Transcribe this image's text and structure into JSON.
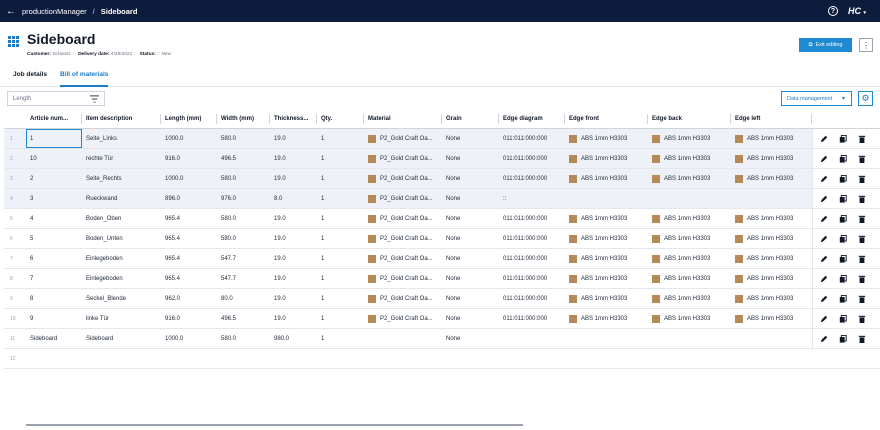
{
  "topbar": {
    "app": "productionManager",
    "separator": "/",
    "page": "Sideboard",
    "help": "?",
    "logo": "HC"
  },
  "header": {
    "title": "Sideboard",
    "customer_label": "Customer:",
    "customer": "Schwarz",
    "delivery_label": "Delivery date:",
    "delivery": "4/29/2022",
    "status_label": "Status:",
    "status": "New",
    "exit_label": "Exit editing"
  },
  "tabs": [
    {
      "label": "Job details",
      "active": false
    },
    {
      "label": "Bill of materials",
      "active": true
    }
  ],
  "filter": {
    "placeholder": "Length"
  },
  "toolbar": {
    "data_management": "Data management"
  },
  "columns": [
    "Article num...",
    "Item description",
    "Length (mm)",
    "Width (mm)",
    "Thickness...",
    "Qty.",
    "Material",
    "Grain",
    "Edge diagram",
    "Edge front",
    "Edge back",
    "Edge left"
  ],
  "rows": [
    {
      "n": "1",
      "article": "1",
      "desc": "Seite_Links",
      "length": "1000.0",
      "width": "580.0",
      "thick": "19.0",
      "qty": "1",
      "material": "P2_Gold Craft Oa...",
      "grain": "None",
      "diagram": "011:011:000:000",
      "front": "ABS 1mm H3303",
      "back": "ABS 1mm H3303",
      "left": "ABS 1mm H3303"
    },
    {
      "n": "2",
      "article": "10",
      "desc": "rechte Tür",
      "length": "916.0",
      "width": "496.5",
      "thick": "19.0",
      "qty": "1",
      "material": "P2_Gold Craft Oa...",
      "grain": "None",
      "diagram": "011:011:000:000",
      "front": "ABS 1mm H3303",
      "back": "ABS 1mm H3303",
      "left": "ABS 1mm H3303"
    },
    {
      "n": "3",
      "article": "2",
      "desc": "Seite_Rechts",
      "length": "1000.0",
      "width": "580.0",
      "thick": "19.0",
      "qty": "1",
      "material": "P2_Gold Craft Oa...",
      "grain": "None",
      "diagram": "011:011:000:000",
      "front": "ABS 1mm H3303",
      "back": "ABS 1mm H3303",
      "left": "ABS 1mm H3303"
    },
    {
      "n": "4",
      "article": "3",
      "desc": "Rueckwand",
      "length": "896.0",
      "width": "976.0",
      "thick": "8.0",
      "qty": "1",
      "material": "P2_Gold Craft Oa...",
      "grain": "None",
      "diagram": "::",
      "front": "",
      "back": "",
      "left": ""
    },
    {
      "n": "5",
      "article": "4",
      "desc": "Boden_Oben",
      "length": "965.4",
      "width": "580.0",
      "thick": "19.0",
      "qty": "1",
      "material": "P2_Gold Craft Oa...",
      "grain": "None",
      "diagram": "011:011:000:000",
      "front": "ABS 1mm H3303",
      "back": "ABS 1mm H3303",
      "left": "ABS 1mm H3303"
    },
    {
      "n": "6",
      "article": "5",
      "desc": "Boden_Unten",
      "length": "965.4",
      "width": "580.0",
      "thick": "19.0",
      "qty": "1",
      "material": "P2_Gold Craft Oa...",
      "grain": "None",
      "diagram": "011:011:000:000",
      "front": "ABS 1mm H3303",
      "back": "ABS 1mm H3303",
      "left": "ABS 1mm H3303"
    },
    {
      "n": "7",
      "article": "6",
      "desc": "Einlegeboden",
      "length": "965.4",
      "width": "547.7",
      "thick": "19.0",
      "qty": "1",
      "material": "P2_Gold Craft Oa...",
      "grain": "None",
      "diagram": "011:011:000:000",
      "front": "ABS 1mm H3303",
      "back": "ABS 1mm H3303",
      "left": "ABS 1mm H3303"
    },
    {
      "n": "8",
      "article": "7",
      "desc": "Einlegeboden",
      "length": "965.4",
      "width": "547.7",
      "thick": "19.0",
      "qty": "1",
      "material": "P2_Gold Craft Oa...",
      "grain": "None",
      "diagram": "011:011:000:000",
      "front": "ABS 1mm H3303",
      "back": "ABS 1mm H3303",
      "left": "ABS 1mm H3303"
    },
    {
      "n": "9",
      "article": "8",
      "desc": "Seckel_Blende",
      "length": "962.0",
      "width": "80.0",
      "thick": "19.0",
      "qty": "1",
      "material": "P2_Gold Craft Oa...",
      "grain": "None",
      "diagram": "011:011:000:000",
      "front": "ABS 1mm H3303",
      "back": "ABS 1mm H3303",
      "left": "ABS 1mm H3303"
    },
    {
      "n": "10",
      "article": "9",
      "desc": "linke Tür",
      "length": "916.0",
      "width": "496.5",
      "thick": "19.0",
      "qty": "1",
      "material": "P2_Gold Craft Oa...",
      "grain": "None",
      "diagram": "011:011:000:000",
      "front": "ABS 1mm H3303",
      "back": "ABS 1mm H3303",
      "left": "ABS 1mm H3303"
    },
    {
      "n": "11",
      "article": "Sideboard",
      "desc": "Sideboard",
      "length": "1000.0",
      "width": "580.0",
      "thick": "980.0",
      "qty": "1",
      "material": "",
      "grain": "None",
      "diagram": "",
      "front": "",
      "back": "",
      "left": ""
    }
  ],
  "empty_row_number": "12",
  "colors": {
    "topbar": "#0d1b3d",
    "accent": "#1f8ad1",
    "swatch": "#b58a58"
  }
}
